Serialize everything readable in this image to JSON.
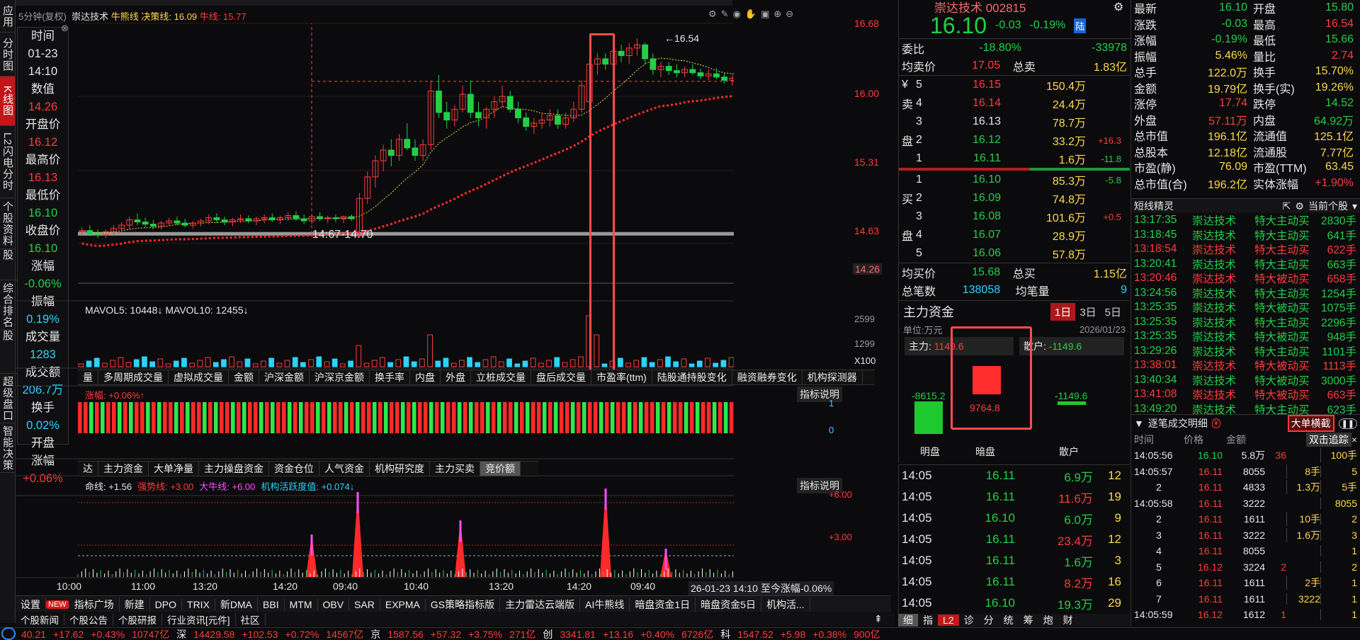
{
  "left_tabs": [
    "应用",
    "分时图",
    "K线图",
    "L2闪电分时",
    "个股资料",
    "自选股",
    "综合排名",
    "牛叉诊股",
    "超级盘口",
    "智能决策"
  ],
  "top": {
    "period_label": "5分钟(复权)",
    "stock_name": "崇达技术",
    "bull_label": "牛熊线",
    "decision_label": "决策线: 16.09",
    "bear_label": "牛线: 15.77",
    "strategy_tab": "GS策略"
  },
  "cursor": {
    "items": [
      {
        "label": "时间",
        "value": "01-23",
        "color": "w"
      },
      {
        "label": "",
        "value": "14:10",
        "color": "w"
      },
      {
        "label": "数值",
        "value": "14.26",
        "color": "r"
      },
      {
        "label": "开盘价",
        "value": "16.12",
        "color": "r"
      },
      {
        "label": "最高价",
        "value": "16.13",
        "color": "r"
      },
      {
        "label": "最低价",
        "value": "16.10",
        "color": "g"
      },
      {
        "label": "收盘价",
        "value": "16.10",
        "color": "g"
      },
      {
        "label": "涨幅",
        "value": "-0.06%",
        "color": "g"
      },
      {
        "label": "振幅",
        "value": "0.19%",
        "color": "c"
      },
      {
        "label": "成交量",
        "value": "1283",
        "color": "c"
      },
      {
        "label": "成交额",
        "value": "206.7万",
        "color": "c"
      },
      {
        "label": "换手",
        "value": "0.02%",
        "color": "c"
      },
      {
        "label": "开盘",
        "value": "",
        "color": "w"
      },
      {
        "label": "涨幅",
        "value": "+0.06%",
        "color": "r"
      }
    ]
  },
  "chart_data": {
    "type": "candlestick",
    "y_ticks": [
      "16.68",
      "16.00",
      "15.31",
      "14.63",
      "14.26"
    ],
    "annotations": {
      "peak": "16.54",
      "support": "14:67-14.70"
    },
    "x_ticks": [
      "10:00",
      "11:00",
      "13:20",
      "14:20",
      "09:40",
      "10:40",
      "13:20",
      "14:20",
      "09:40"
    ],
    "ohlc": [
      [
        14.74,
        14.78,
        14.7,
        14.75
      ],
      [
        14.75,
        14.8,
        14.7,
        14.72
      ],
      [
        14.72,
        14.76,
        14.68,
        14.71
      ],
      [
        14.71,
        14.76,
        14.68,
        14.74
      ],
      [
        14.74,
        14.8,
        14.71,
        14.77
      ],
      [
        14.77,
        14.83,
        14.74,
        14.8
      ],
      [
        14.8,
        14.88,
        14.76,
        14.85
      ],
      [
        14.85,
        14.91,
        14.8,
        14.83
      ],
      [
        14.83,
        14.87,
        14.78,
        14.81
      ],
      [
        14.81,
        14.85,
        14.76,
        14.79
      ],
      [
        14.79,
        14.84,
        14.76,
        14.82
      ],
      [
        14.82,
        14.87,
        14.79,
        14.84
      ],
      [
        14.84,
        14.88,
        14.8,
        14.82
      ],
      [
        14.82,
        14.86,
        14.78,
        14.8
      ],
      [
        14.8,
        14.84,
        14.77,
        14.82
      ],
      [
        14.82,
        14.86,
        14.79,
        14.84
      ],
      [
        14.84,
        14.9,
        14.81,
        14.87
      ],
      [
        14.87,
        14.91,
        14.82,
        14.85
      ],
      [
        14.85,
        14.88,
        14.8,
        14.83
      ],
      [
        14.83,
        14.87,
        14.79,
        14.85
      ],
      [
        14.85,
        14.9,
        14.82,
        14.86
      ],
      [
        14.86,
        14.89,
        14.82,
        14.84
      ],
      [
        14.84,
        14.88,
        14.8,
        14.86
      ],
      [
        14.86,
        14.9,
        14.82,
        14.87
      ],
      [
        14.87,
        14.91,
        14.83,
        14.85
      ],
      [
        14.85,
        14.89,
        14.81,
        14.87
      ],
      [
        14.87,
        14.92,
        14.84,
        14.89
      ],
      [
        14.89,
        14.93,
        14.84,
        14.86
      ],
      [
        14.86,
        14.9,
        14.81,
        14.84
      ],
      [
        14.84,
        14.9,
        14.81,
        14.88
      ],
      [
        14.88,
        14.92,
        14.84,
        14.86
      ],
      [
        14.86,
        14.89,
        14.82,
        14.87
      ],
      [
        14.87,
        14.9,
        14.83,
        14.86
      ],
      [
        14.86,
        14.89,
        14.82,
        14.88
      ],
      [
        14.88,
        14.9,
        14.84,
        14.86
      ],
      [
        14.7,
        15.1,
        14.69,
        15.05
      ],
      [
        15.05,
        15.3,
        15.0,
        15.25
      ],
      [
        15.25,
        15.45,
        15.15,
        15.4
      ],
      [
        15.4,
        15.55,
        15.3,
        15.5
      ],
      [
        15.5,
        15.6,
        15.35,
        15.45
      ],
      [
        15.45,
        15.65,
        15.4,
        15.6
      ],
      [
        15.6,
        15.75,
        15.5,
        15.52
      ],
      [
        15.52,
        15.6,
        15.4,
        15.45
      ],
      [
        15.45,
        15.6,
        15.4,
        15.55
      ],
      [
        15.55,
        16.15,
        15.5,
        16.05
      ],
      [
        16.05,
        16.2,
        15.8,
        15.85
      ],
      [
        15.85,
        15.95,
        15.7,
        15.78
      ],
      [
        15.78,
        15.92,
        15.72,
        15.88
      ],
      [
        15.88,
        16.1,
        15.85,
        16.02
      ],
      [
        16.02,
        16.15,
        15.8,
        15.85
      ],
      [
        15.85,
        15.95,
        15.72,
        15.8
      ],
      [
        15.8,
        15.9,
        15.7,
        15.88
      ],
      [
        15.88,
        16.0,
        15.8,
        15.95
      ],
      [
        15.95,
        16.1,
        15.9,
        16.0
      ],
      [
        16.0,
        16.05,
        15.85,
        15.88
      ],
      [
        15.88,
        15.95,
        15.75,
        15.8
      ],
      [
        15.8,
        15.85,
        15.68,
        15.72
      ],
      [
        15.72,
        15.8,
        15.65,
        15.75
      ],
      [
        15.75,
        15.85,
        15.7,
        15.78
      ],
      [
        15.78,
        15.88,
        15.72,
        15.82
      ],
      [
        15.82,
        15.88,
        15.7,
        15.74
      ],
      [
        15.74,
        15.85,
        15.7,
        15.8
      ],
      [
        15.8,
        15.95,
        15.76,
        15.88
      ],
      [
        15.88,
        16.15,
        15.85,
        16.1
      ],
      [
        15.95,
        16.35,
        15.8,
        16.3
      ],
      [
        16.3,
        16.4,
        16.2,
        16.35
      ],
      [
        16.35,
        16.4,
        16.25,
        16.3
      ],
      [
        16.3,
        16.45,
        16.28,
        16.42
      ],
      [
        16.42,
        16.48,
        16.32,
        16.38
      ],
      [
        16.38,
        16.5,
        16.3,
        16.45
      ],
      [
        16.45,
        16.54,
        16.38,
        16.48
      ],
      [
        16.48,
        16.5,
        16.3,
        16.35
      ],
      [
        16.35,
        16.4,
        16.2,
        16.25
      ],
      [
        16.25,
        16.32,
        16.18,
        16.28
      ],
      [
        16.28,
        16.32,
        16.2,
        16.24
      ],
      [
        16.24,
        16.3,
        16.18,
        16.22
      ],
      [
        16.22,
        16.28,
        16.18,
        16.25
      ],
      [
        16.25,
        16.3,
        16.2,
        16.22
      ],
      [
        16.22,
        16.26,
        16.16,
        16.19
      ],
      [
        16.19,
        16.25,
        16.15,
        16.21
      ],
      [
        16.21,
        16.26,
        16.16,
        16.18
      ],
      [
        16.18,
        16.22,
        16.12,
        16.15
      ],
      [
        16.15,
        16.2,
        16.1,
        16.17
      ],
      [
        16.17,
        16.3,
        16.14,
        16.2
      ],
      [
        16.2,
        16.24,
        16.12,
        16.14
      ],
      [
        16.14,
        16.18,
        16.08,
        16.11
      ],
      [
        16.11,
        16.16,
        16.06,
        16.13
      ],
      [
        16.13,
        16.17,
        16.07,
        16.09
      ],
      [
        16.09,
        16.14,
        16.04,
        16.11
      ],
      [
        16.11,
        16.15,
        16.05,
        16.07
      ],
      [
        16.07,
        16.12,
        16.02,
        16.09
      ],
      [
        16.09,
        16.14,
        16.04,
        16.1
      ],
      [
        16.1,
        16.16,
        16.06,
        16.14
      ],
      [
        16.14,
        16.18,
        16.08,
        16.12
      ],
      [
        16.12,
        16.16,
        16.08,
        16.1
      ],
      [
        16.1,
        16.13,
        16.08,
        16.1
      ]
    ]
  },
  "vol": {
    "label": "MAVOL5: 10448↓ MAVOL10: 12455↓",
    "ticks": [
      "2599",
      "1299",
      "X100"
    ]
  },
  "indicator_tabs": [
    "量",
    "多周期成交量",
    "虚拟成交量",
    "金额",
    "沪深金额",
    "沪深京金额",
    "换手率",
    "内盘",
    "外盘",
    "立桩成交量",
    "盘后成交量",
    "市盈率(ttm)",
    "陆股通持股变化",
    "融资融券变化",
    "机构探测器"
  ],
  "ind1": {
    "label": "涨幅: +0.06%↑",
    "explain": "指标说明",
    "ticks": [
      "1",
      "0"
    ]
  },
  "ind2_tabs": [
    "达",
    "主力资金",
    "大单净量",
    "主力操盘资金",
    "资金仓位",
    "人气资金",
    "机构研究度",
    "主力买卖",
    "竞价额"
  ],
  "ind2": {
    "life": "命线: +1.56",
    "strong": "强势线: +3.00",
    "bull": "大牛线: +6.00",
    "inst": "机构活跃度值: +0.074↓",
    "explain": "指标说明",
    "ticks": [
      "+6.00",
      "+3.00"
    ]
  },
  "time_status": "26-01-23 14:10 至今涨幅-0.06%",
  "toolbar": [
    "设置",
    "NEW",
    "指标广场",
    "新建",
    "DPO",
    "TRIX",
    "新DMA",
    "BBI",
    "MTM",
    "OBV",
    "SAR",
    "EXPMA",
    "GS策略指标版",
    "主力雷达云端版",
    "AI牛熊线",
    "暗盘资金1日",
    "暗盘资金5日",
    "机构活..."
  ],
  "news_tabs": [
    "个股新闻",
    "个股公告",
    "个股研报",
    "行业资讯[元件]",
    "社区"
  ],
  "status_bar": [
    "40.21",
    "+17.62",
    "+0.43%",
    "10747亿",
    "深",
    "14429.58",
    "+102.53",
    "+0.72%",
    "14567亿",
    "京",
    "1587.56",
    "+57.32",
    "+3.75%",
    "271亿",
    "创",
    "3341.81",
    "+13.16",
    "+0.40%",
    "6726亿",
    "科",
    "1547.52",
    "+5.98",
    "+0.38%",
    "900亿"
  ],
  "quote": {
    "title": "崇达技术 002815",
    "price": "16.10",
    "change": "-0.03",
    "pct": "-0.19%",
    "tag": "陆",
    "weibi_l": "委比",
    "weibi": "-18.80%",
    "weicha": "-33978",
    "avg_sell_l": "均卖价",
    "avg_sell": "17.05",
    "total_sell_l": "总卖",
    "total_sell": "1.83亿",
    "avg_buy_l": "均买价",
    "avg_buy": "15.68",
    "total_buy_l": "总买",
    "total_buy": "1.15亿",
    "trades_l": "总笔数",
    "trades": "138058",
    "avg_vol_l": "均笔量",
    "avg_vol": "9"
  },
  "sells": [
    {
      "side": "¥",
      "n": "5",
      "p": "16.15",
      "v": "150.4万",
      "d": ""
    },
    {
      "side": "卖",
      "n": "4",
      "p": "16.14",
      "v": "24.4万",
      "d": ""
    },
    {
      "side": "",
      "n": "3",
      "p": "16.13",
      "v": "78.7万",
      "d": ""
    },
    {
      "side": "盘",
      "n": "2",
      "p": "16.12",
      "v": "33.2万",
      "d": "+16.3"
    },
    {
      "side": "",
      "n": "1",
      "p": "16.11",
      "v": "1.6万",
      "d": "-11.8"
    }
  ],
  "buys": [
    {
      "side": "",
      "n": "1",
      "p": "16.10",
      "v": "85.3万",
      "d": "-5.8"
    },
    {
      "side": "买",
      "n": "2",
      "p": "16.09",
      "v": "74.8万",
      "d": ""
    },
    {
      "side": "",
      "n": "3",
      "p": "16.08",
      "v": "101.6万",
      "d": "+0.5"
    },
    {
      "side": "盘",
      "n": "4",
      "p": "16.07",
      "v": "28.9万",
      "d": ""
    },
    {
      "side": "",
      "n": "5",
      "p": "16.06",
      "v": "57.8万",
      "d": ""
    }
  ],
  "capital": {
    "title": "主力资金",
    "tabs": [
      "1日",
      "3日",
      "5日"
    ],
    "unit": "单位:万元",
    "date": "2026/01/23",
    "main_l": "主力:",
    "main_v": "1149.6",
    "retail_l": "散户:",
    "retail_v": "-1149.6",
    "bright": "-8615.2",
    "dark": "9764.8",
    "retail": "-1149.6",
    "labels": [
      "明盘",
      "暗盘",
      "散户"
    ]
  },
  "mini": [
    {
      "t": "14:05",
      "p": "16.11",
      "v": "6.9万",
      "n": "12"
    },
    {
      "t": "14:05",
      "p": "16.11",
      "v": "11.6万",
      "n": "19"
    },
    {
      "t": "14:05",
      "p": "16.10",
      "v": "6.0万",
      "n": "9"
    },
    {
      "t": "14:05",
      "p": "16.11",
      "v": "23.4万",
      "n": "12"
    },
    {
      "t": "14:05",
      "p": "16.11",
      "v": "1.6万",
      "n": "3"
    },
    {
      "t": "14:05",
      "p": "16.11",
      "v": "8.2万",
      "n": "16"
    },
    {
      "t": "14:05",
      "p": "16.10",
      "v": "19.3万",
      "n": "29"
    }
  ],
  "mini_tabs": [
    "细",
    "指",
    "L2",
    "诊",
    "分",
    "统",
    "筹",
    "炮",
    "财"
  ],
  "stats": [
    {
      "l1": "最新",
      "v1": "16.10",
      "c1": "g",
      "l2": "开盘",
      "v2": "15.80",
      "c2": "g"
    },
    {
      "l1": "涨跌",
      "v1": "-0.03",
      "c1": "g",
      "l2": "最高",
      "v2": "16.54",
      "c2": "r"
    },
    {
      "l1": "涨幅",
      "v1": "-0.19%",
      "c1": "g",
      "l2": "最低",
      "v2": "15.66",
      "c2": "g"
    },
    {
      "l1": "振幅",
      "v1": "5.46%",
      "c1": "y",
      "l2": "量比",
      "v2": "2.74",
      "c2": "r"
    },
    {
      "l1": "总手",
      "v1": "122.0万",
      "c1": "y",
      "l2": "换手",
      "v2": "15.70%",
      "c2": "y"
    },
    {
      "l1": "金额",
      "v1": "19.79亿",
      "c1": "y",
      "l2": "换手(实)",
      "v2": "19.26%",
      "c2": "y"
    },
    {
      "l1": "涨停",
      "v1": "17.74",
      "c1": "r",
      "l2": "跌停",
      "v2": "14.52",
      "c2": "g"
    },
    {
      "l1": "外盘",
      "v1": "57.11万",
      "c1": "r",
      "l2": "内盘",
      "v2": "64.92万",
      "c2": "g"
    },
    {
      "l1": "总市值",
      "v1": "196.1亿",
      "c1": "y",
      "l2": "流通值",
      "v2": "125.1亿",
      "c2": "y"
    },
    {
      "l1": "总股本",
      "v1": "12.18亿",
      "c1": "y",
      "l2": "流通股",
      "v2": "7.77亿",
      "c2": "y"
    },
    {
      "l1": "市盈(静)",
      "v1": "76.09",
      "c1": "y",
      "l2": "市盈(TTM)",
      "v2": "63.45",
      "c2": "y"
    },
    {
      "l1": "总市值(合)",
      "v1": "196.2亿",
      "c1": "y",
      "l2": "实体涨幅",
      "v2": "+1.90%",
      "c2": "r"
    }
  ],
  "short": {
    "title": "短线精灵",
    "scope": "当前个股",
    "rows": [
      {
        "t": "13:17:35",
        "s": "崇达技术",
        "e": "特大主动买",
        "v": "2830手",
        "c": "g"
      },
      {
        "t": "13:18:45",
        "s": "崇达技术",
        "e": "特大主动买",
        "v": "641手",
        "c": "g"
      },
      {
        "t": "13:18:54",
        "s": "崇达技术",
        "e": "特大主动买",
        "v": "622手",
        "c": "r"
      },
      {
        "t": "13:20:41",
        "s": "崇达技术",
        "e": "特大主动买",
        "v": "663手",
        "c": "g"
      },
      {
        "t": "13:20:46",
        "s": "崇达技术",
        "e": "特大被动买",
        "v": "658手",
        "c": "r"
      },
      {
        "t": "13:24:56",
        "s": "崇达技术",
        "e": "特大主动买",
        "v": "1254手",
        "c": "g"
      },
      {
        "t": "13:25:35",
        "s": "崇达技术",
        "e": "特大被动买",
        "v": "1075手",
        "c": "g"
      },
      {
        "t": "13:25:35",
        "s": "崇达技术",
        "e": "特大主动买",
        "v": "2296手",
        "c": "g"
      },
      {
        "t": "13:25:35",
        "s": "崇达技术",
        "e": "特大被动买",
        "v": "948手",
        "c": "g"
      },
      {
        "t": "13:29:26",
        "s": "崇达技术",
        "e": "特大主动买",
        "v": "1101手",
        "c": "g"
      },
      {
        "t": "13:38:01",
        "s": "崇达技术",
        "e": "特大被动买",
        "v": "1113手",
        "c": "r"
      },
      {
        "t": "13:40:34",
        "s": "崇达技术",
        "e": "特大被动买",
        "v": "3000手",
        "c": "g"
      },
      {
        "t": "13:41:08",
        "s": "崇达技术",
        "e": "特大被动买",
        "v": "663手",
        "c": "r"
      },
      {
        "t": "13:49:20",
        "s": "崇达技术",
        "e": "特大主动买",
        "v": "623手",
        "c": "g"
      }
    ]
  },
  "ticks": {
    "title": "逐笔成交明细",
    "filter": "大单横截",
    "tracking": "双击追踪",
    "headers": [
      "时间",
      "价格",
      "金额"
    ],
    "rows": [
      {
        "t": "14:05:56",
        "p": "16.10",
        "a": "5.8万",
        "c": "36",
        "x": "",
        "y": "100手"
      },
      {
        "t": "14:05:57",
        "p": "16.11",
        "a": "8055",
        "c": "",
        "x": "8手",
        "y": "5"
      },
      {
        "t": "2",
        "p": "16.11",
        "a": "4833",
        "c": "",
        "x": "1.3万",
        "y": "5手"
      },
      {
        "t": "14:05:58",
        "p": "16.11",
        "a": "3222",
        "c": "",
        "x": "",
        "y": "8055"
      },
      {
        "t": "2",
        "p": "16.11",
        "a": "1611",
        "c": "",
        "x": "10手",
        "y": "2"
      },
      {
        "t": "3",
        "p": "16.11",
        "a": "3222",
        "c": "",
        "x": "1.6万",
        "y": "3"
      },
      {
        "t": "4",
        "p": "16.11",
        "a": "8055",
        "c": "",
        "x": "",
        "y": "1"
      },
      {
        "t": "5",
        "p": "16.12",
        "a": "3224",
        "c": "2",
        "x": "",
        "y": "2"
      },
      {
        "t": "6",
        "p": "16.11",
        "a": "1611",
        "c": "",
        "x": "2手",
        "y": "1"
      },
      {
        "t": "7",
        "p": "16.11",
        "a": "1611",
        "c": "",
        "x": "3222",
        "y": "1"
      },
      {
        "t": "14:05:59",
        "p": "16.12",
        "a": "1612",
        "c": "1",
        "x": "",
        "y": "1"
      }
    ]
  },
  "colors": {
    "up": "#ff3a3a",
    "down": "#21d047",
    "accent": "#ff3a3a",
    "bg": "#0b0b0d"
  }
}
